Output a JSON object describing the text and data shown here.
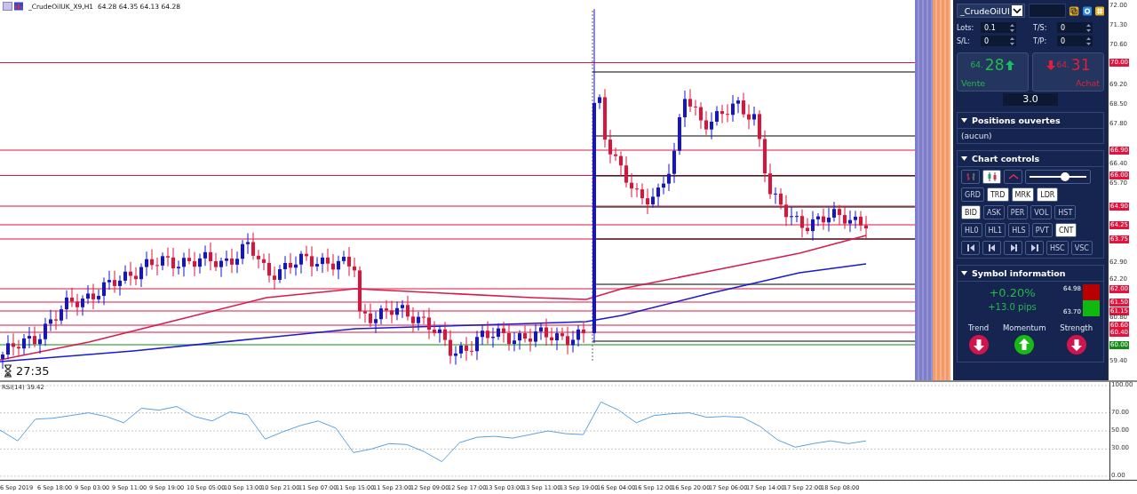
{
  "chart_title": "_CrudeOilUK_X9,H1  64.28 64.35 64.13 64.28",
  "countdown": "27:35",
  "price_axis": [
    {
      "label": "72.00",
      "kind": "tick"
    },
    {
      "label": "71.30",
      "kind": "tick"
    },
    {
      "label": "70.60",
      "kind": "tick"
    },
    {
      "label": "70.00",
      "kind": "level",
      "color": "#e0143c"
    },
    {
      "label": "69.20",
      "kind": "tick"
    },
    {
      "label": "68.50",
      "kind": "tick"
    },
    {
      "label": "67.80",
      "kind": "tick"
    },
    {
      "label": "66.90",
      "kind": "level",
      "color": "#e0143c"
    },
    {
      "label": "66.40",
      "kind": "tick"
    },
    {
      "label": "66.00",
      "kind": "level",
      "color": "#e0143c"
    },
    {
      "label": "65.70",
      "kind": "tick"
    },
    {
      "label": "64.90",
      "kind": "level",
      "color": "#e0143c"
    },
    {
      "label": "64.25",
      "kind": "level",
      "color": "#e0143c"
    },
    {
      "label": "63.75",
      "kind": "level",
      "color": "#e0143c"
    },
    {
      "label": "62.90",
      "kind": "tick"
    },
    {
      "label": "62.20",
      "kind": "tick"
    },
    {
      "label": "62.00",
      "kind": "level",
      "color": "#e0143c"
    },
    {
      "label": "61.50",
      "kind": "level",
      "color": "#e0143c"
    },
    {
      "label": "61.15",
      "kind": "level",
      "color": "#e0143c"
    },
    {
      "label": "60.80",
      "kind": "tick"
    },
    {
      "label": "60.60",
      "kind": "level",
      "color": "#e0143c"
    },
    {
      "label": "60.40",
      "kind": "level",
      "color": "#e0143c"
    },
    {
      "label": "60.00",
      "kind": "level",
      "color": "#108a10"
    },
    {
      "label": "59.40",
      "kind": "tick"
    }
  ],
  "panel": {
    "symbol": "_CrudeOilUI",
    "fields": [
      {
        "label": "Lots:",
        "value": "0.1"
      },
      {
        "label": "T/S:",
        "value": "0"
      },
      {
        "label": "S/L:",
        "value": "0"
      },
      {
        "label": "T/P:",
        "value": "0"
      }
    ],
    "sell": {
      "price_small": "64.",
      "price_big": "28",
      "label": "Vente"
    },
    "buy": {
      "price_small": "64.",
      "price_big": "31",
      "label": "Achat"
    },
    "spread": "3.0",
    "positions": {
      "title": "Positions ouvertes",
      "expanded": true,
      "content": "(aucun)"
    },
    "chart_controls": {
      "title": "Chart controls",
      "expanded": true,
      "icon_buttons": [
        {
          "kind": "bars",
          "selected": false
        },
        {
          "kind": "candles",
          "selected": true
        },
        {
          "kind": "line",
          "selected": false
        }
      ],
      "zoom_slider": {
        "level": 0.62
      },
      "button_rows": [
        [
          {
            "label": "GRD",
            "selected": false
          },
          {
            "label": "TRD",
            "selected": true
          },
          {
            "label": "MRK",
            "selected": true
          },
          {
            "label": "LDR",
            "selected": true
          }
        ],
        [
          {
            "label": "BID",
            "selected": true
          },
          {
            "label": "ASK",
            "selected": false
          },
          {
            "label": "PER",
            "selected": false
          },
          {
            "label": "VOL",
            "selected": false
          },
          {
            "label": "HST",
            "selected": false
          }
        ],
        [
          {
            "label": "HL0",
            "selected": false
          },
          {
            "label": "HL1",
            "selected": false
          },
          {
            "label": "HLS",
            "selected": false
          },
          {
            "label": "PVT",
            "selected": false
          },
          {
            "label": "CNT",
            "selected": true
          }
        ]
      ],
      "nav_buttons": [
        {
          "kind": "first"
        },
        {
          "kind": "prev"
        },
        {
          "kind": "next"
        },
        {
          "kind": "last"
        },
        {
          "kind": "text",
          "label": "HSC"
        },
        {
          "kind": "text",
          "label": "VSC"
        }
      ]
    },
    "symbol_info": {
      "title": "Symbol information",
      "expanded": true,
      "change_percent": "+0.20%",
      "change_pips": "+13.0 pips",
      "high": "64.98",
      "low": "63.70",
      "indicators": [
        {
          "label": "Trend",
          "kind": "down"
        },
        {
          "label": "Momentum",
          "kind": "up"
        },
        {
          "label": "Strength",
          "kind": "down"
        }
      ]
    }
  },
  "rsi": {
    "value": "39.42",
    "chart_data": {
      "type": "line",
      "ylim": [
        -4,
        104
      ],
      "grid": true,
      "yticks": [
        {
          "value": 100,
          "label": "100.00"
        },
        {
          "value": 70,
          "label": "70.00"
        },
        {
          "value": 50,
          "label": "50.00"
        },
        {
          "value": 30,
          "label": "30.00"
        },
        {
          "value": 0,
          "label": "0.00"
        }
      ],
      "series": [
        {
          "name": "RSI(14)",
          "color": "#5aa0e0",
          "values": [
            51,
            39,
            63,
            64,
            67,
            70,
            66,
            59,
            75,
            73,
            77,
            66,
            61,
            71,
            68,
            41,
            49,
            56,
            61,
            53,
            26,
            30,
            36,
            35,
            27,
            16,
            37,
            43,
            44,
            42,
            46,
            50,
            47,
            46,
            82,
            73,
            59,
            67,
            69,
            70,
            65,
            66,
            65,
            55,
            40,
            32,
            36,
            39,
            36,
            39
          ]
        }
      ]
    }
  },
  "time_axis": [
    "6 Sep 2019",
    "6 Sep 18:00",
    "9 Sep 03:00",
    "9 Sep 11:00",
    "9 Sep 19:00",
    "10 Sep 05:00",
    "10 Sep 13:00",
    "10 Sep 21:00",
    "11 Sep 07:00",
    "11 Sep 15:00",
    "11 Sep 23:00",
    "12 Sep 09:00",
    "12 Sep 17:00",
    "13 Sep 03:00",
    "13 Sep 11:00",
    "13 Sep 19:00",
    "16 Sep 04:00",
    "16 Sep 12:00",
    "16 Sep 20:00",
    "17 Sep 06:00",
    "17 Sep 14:00",
    "17 Sep 22:00",
    "18 Sep 08:00"
  ]
}
